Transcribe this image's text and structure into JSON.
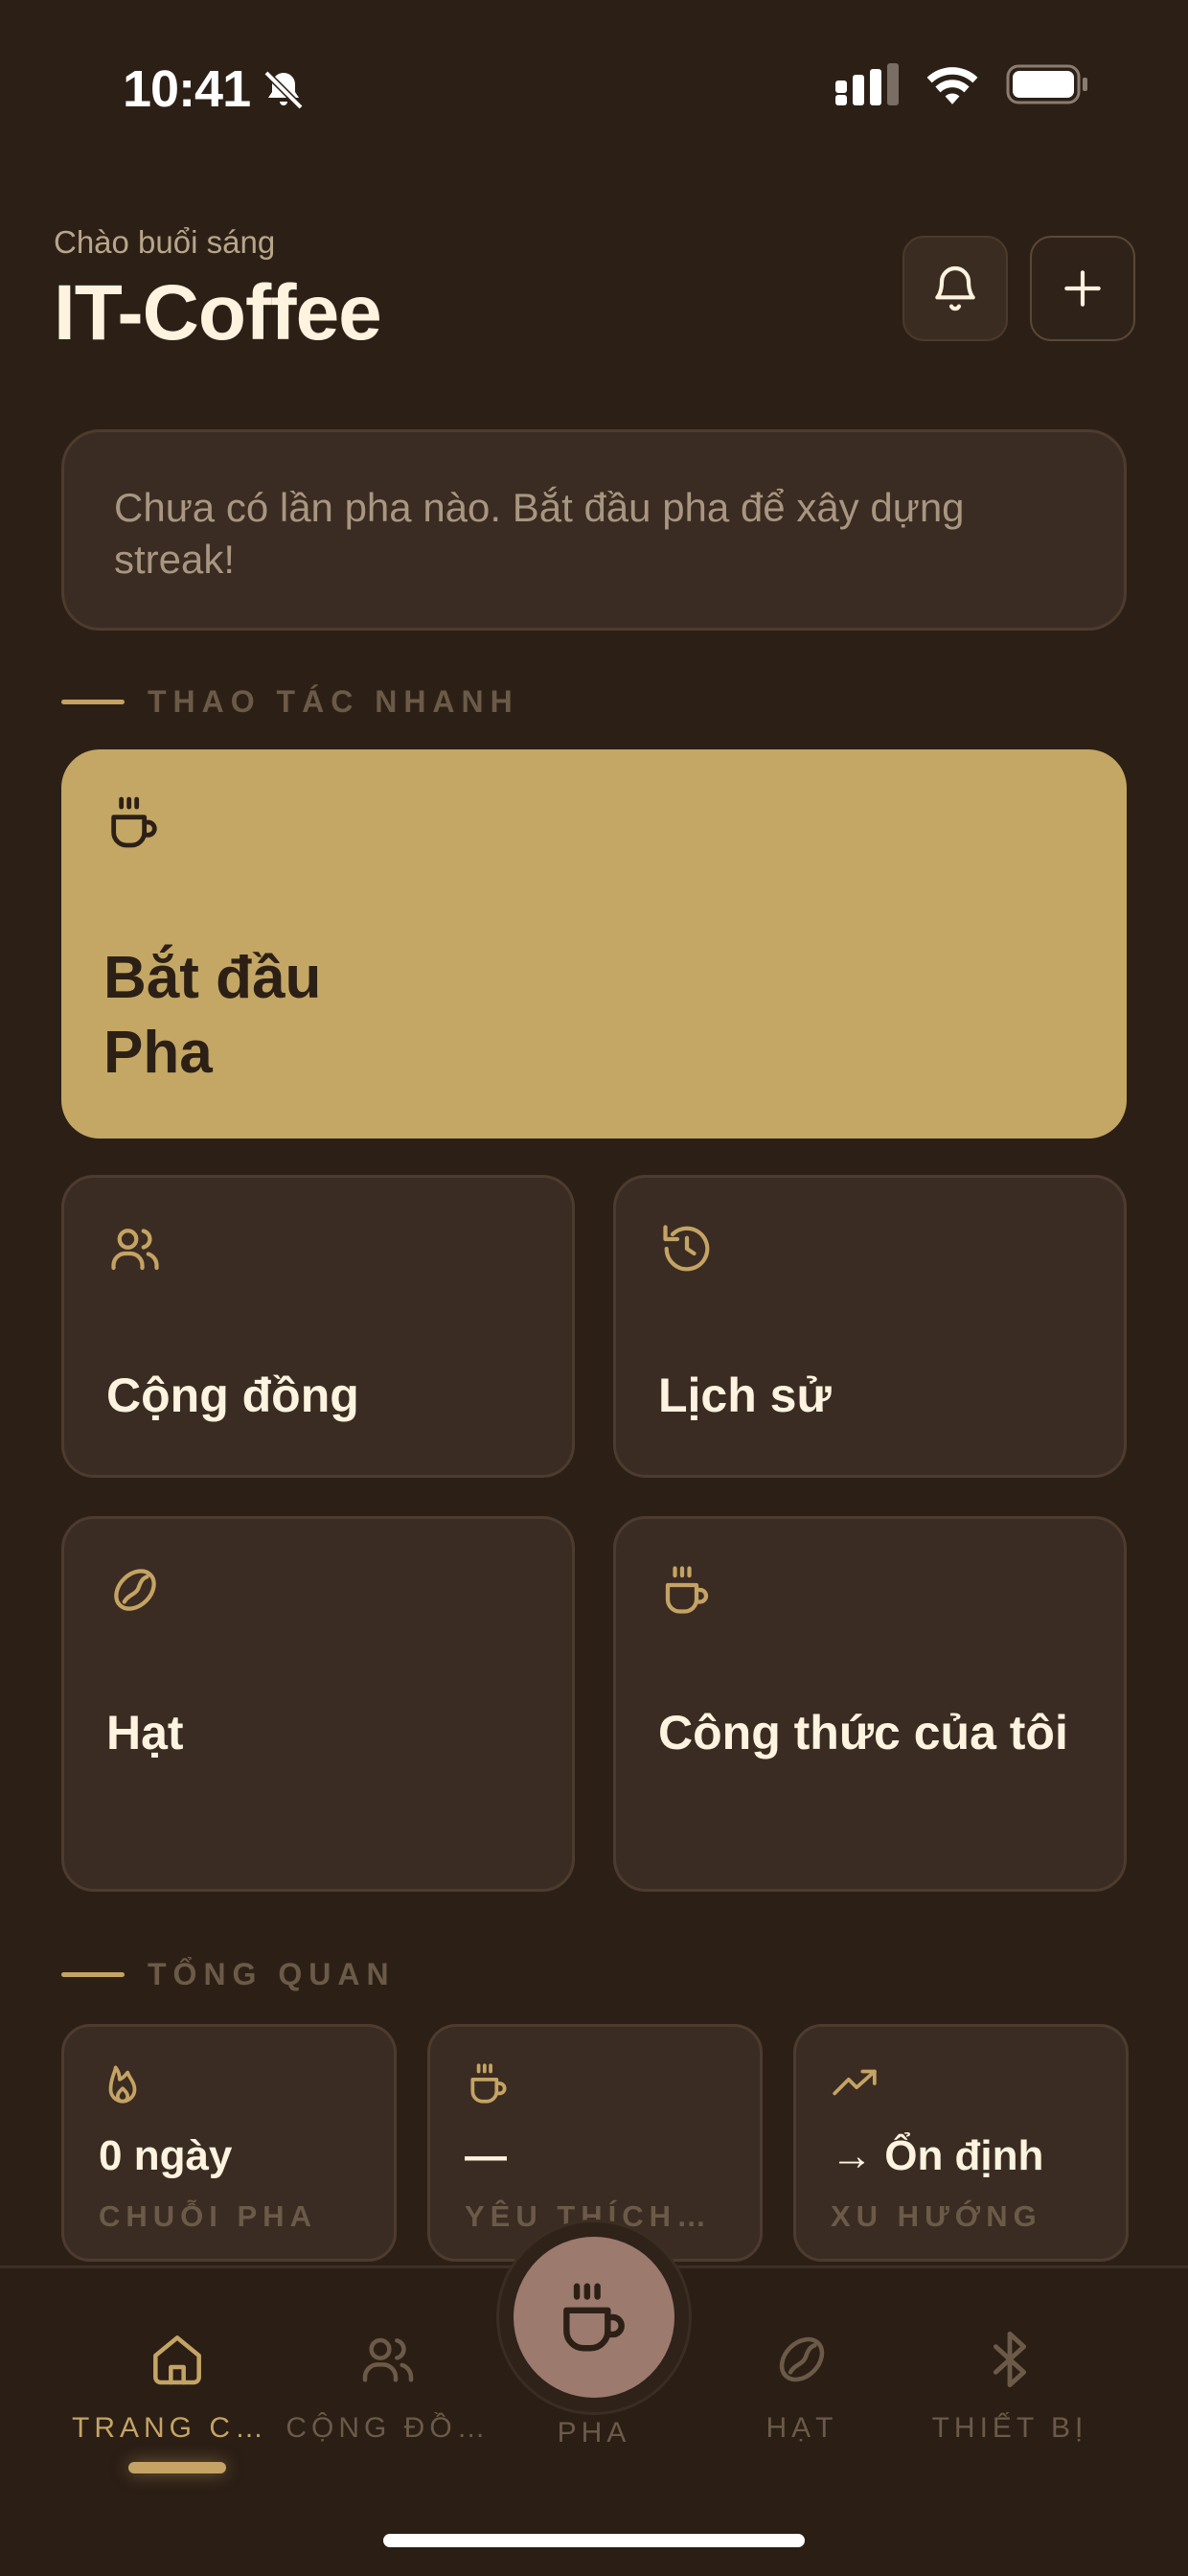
{
  "status_bar": {
    "time": "10:41"
  },
  "header": {
    "greeting": "Chào buổi sáng",
    "title": "IT-Coffee"
  },
  "streak_banner": {
    "text": "Chưa có lần pha nào. Bắt đầu pha để xây dựng streak!"
  },
  "sections": {
    "quick_actions": "THAO TÁC NHANH",
    "overview": "TỔNG QUAN"
  },
  "quick_actions": {
    "hero": {
      "line1": "Bắt đầu",
      "line2": "Pha",
      "icon": "coffee-cup-icon"
    },
    "cards": [
      {
        "label": "Cộng đồng",
        "icon": "users-icon"
      },
      {
        "label": "Lịch sử",
        "icon": "history-icon"
      },
      {
        "label": "Hạt",
        "icon": "bean-icon"
      },
      {
        "label": "Công thức của tôi",
        "icon": "coffee-cup-icon"
      }
    ]
  },
  "overview": {
    "stats": [
      {
        "value": "0 ngày",
        "caption": "CHUỖI PHA",
        "icon": "flame-icon"
      },
      {
        "value": "—",
        "caption": "YÊU THÍCH…",
        "icon": "coffee-cup-icon"
      },
      {
        "value": "→ Ổn định",
        "caption": "XU HƯỚNG",
        "icon": "trending-up-icon"
      }
    ]
  },
  "tabbar": {
    "tabs": [
      {
        "label": "TRANG CH…",
        "icon": "home-icon",
        "active": true
      },
      {
        "label": "CỘNG ĐỒ…",
        "icon": "users-icon"
      },
      {
        "label": "PHA",
        "icon": "coffee-cup-icon"
      },
      {
        "label": "HẠT",
        "icon": "bean-icon"
      },
      {
        "label": "THIẾT BỊ",
        "icon": "bluetooth-icon"
      }
    ]
  },
  "colors": {
    "background": "#2c2016",
    "accent": "#c4a764",
    "card": "#3a2c22",
    "muted_text": "#6b5a47"
  }
}
